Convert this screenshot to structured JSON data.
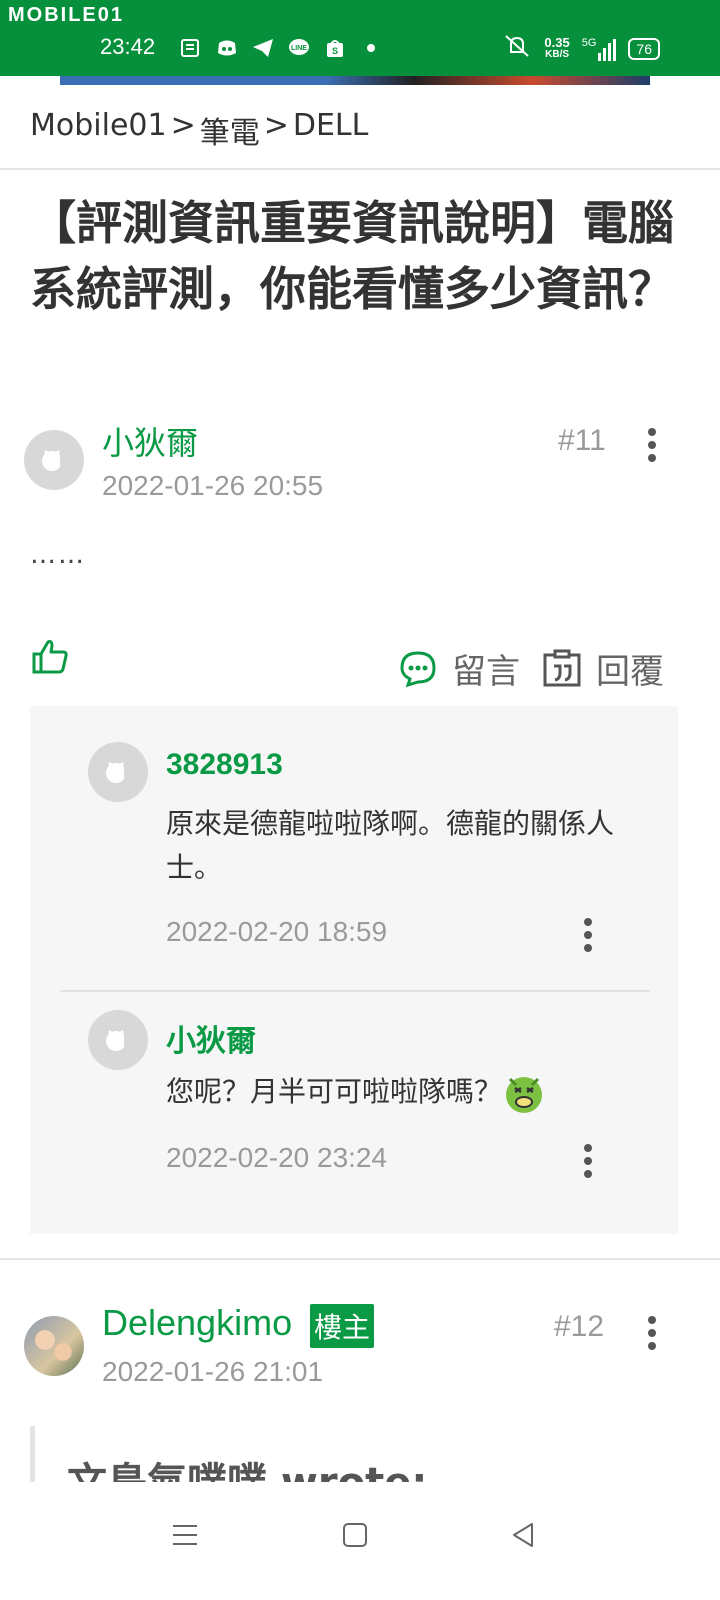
{
  "status_bar": {
    "app_logo": "MOBILE01",
    "time": "23:42",
    "network_speed_value": "0.35",
    "network_speed_unit": "KB/S",
    "network_type": "5G",
    "battery": "76"
  },
  "breadcrumb": {
    "items": [
      "Mobile01",
      "筆電",
      "DELL"
    ],
    "separator": ">"
  },
  "thread": {
    "title": "【評測資訊重要資訊說明】電腦系統評測，你能看懂多少資訊？"
  },
  "post11": {
    "username": "小狄爾",
    "timestamp": "2022-01-26 20:55",
    "floor": "#11",
    "body": "……"
  },
  "actions": {
    "comment_label": "留言",
    "reply_label": "回覆"
  },
  "comments": [
    {
      "username": "3828913",
      "text": "原來是德龍啦啦隊啊。德龍的關係人士。",
      "timestamp": "2022-02-20 18:59"
    },
    {
      "username": "小狄爾",
      "text": "您呢？月半可可啦啦隊嗎？",
      "timestamp": "2022-02-20 23:24"
    }
  ],
  "post12": {
    "username": "Delengkimo",
    "badge": "樓主",
    "timestamp": "2022-01-26 21:01",
    "floor": "#12",
    "quote_preview": "文鳥氣噗噗 wrote:"
  },
  "colors": {
    "brand_green": "#07903c",
    "username_green": "#0a9a45",
    "muted_gray": "#9a9a9a"
  }
}
